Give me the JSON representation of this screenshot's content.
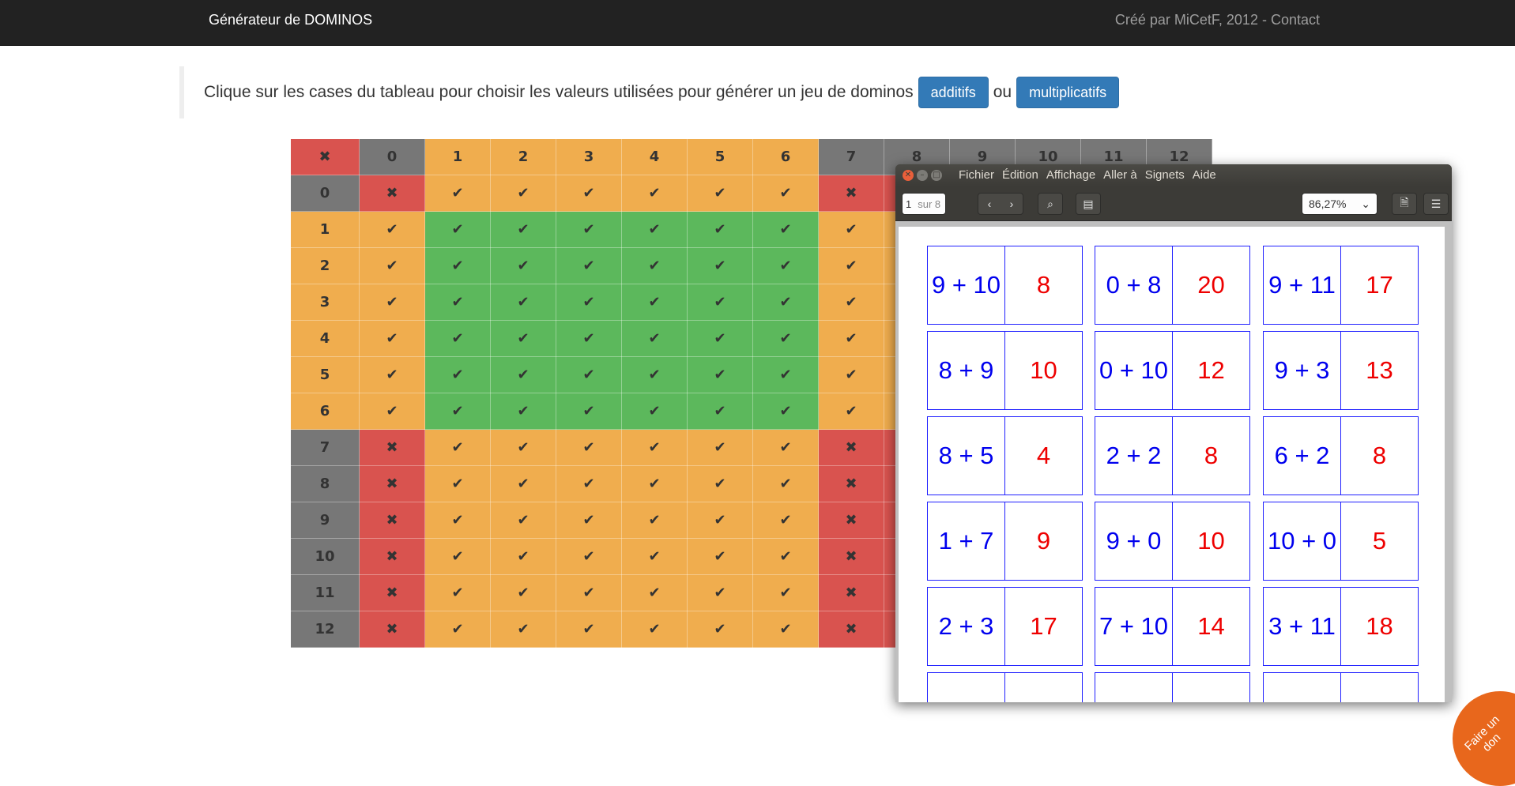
{
  "navbar": {
    "brand": "Générateur de DOMINOS",
    "credit": "Créé par MiCetF, 2012 - Contact"
  },
  "intro": {
    "text": "Clique sur les cases du tableau pour choisir les valeurs utilisées pour générer un jeu de dominos",
    "additifs_label": "additifs",
    "ou": "ou",
    "multiplicatifs_label": "multiplicatifs"
  },
  "table": {
    "corner": "✖",
    "check": "✔",
    "cross": "✖",
    "headers": [
      "0",
      "1",
      "2",
      "3",
      "4",
      "5",
      "6",
      "7",
      "8",
      "9",
      "10",
      "11",
      "12"
    ]
  },
  "viewer": {
    "menu": [
      "Fichier",
      "Édition",
      "Affichage",
      "Aller à",
      "Signets",
      "Aide"
    ],
    "page": "1",
    "page_of": "sur 8",
    "zoom": "86,27%",
    "dominoes": [
      {
        "left": "9 + 10",
        "right": "8"
      },
      {
        "left": "0 + 8",
        "right": "20"
      },
      {
        "left": "9 + 11",
        "right": "17"
      },
      {
        "left": "8 + 9",
        "right": "10"
      },
      {
        "left": "0 + 10",
        "right": "12"
      },
      {
        "left": "9 + 3",
        "right": "13"
      },
      {
        "left": "8 + 5",
        "right": "4"
      },
      {
        "left": "2 + 2",
        "right": "8"
      },
      {
        "left": "6 + 2",
        "right": "8"
      },
      {
        "left": "1 + 7",
        "right": "9"
      },
      {
        "left": "9 + 0",
        "right": "10"
      },
      {
        "left": "10 + 0",
        "right": "5"
      },
      {
        "left": "2 + 3",
        "right": "17"
      },
      {
        "left": "7 + 10",
        "right": "14"
      },
      {
        "left": "3 + 11",
        "right": "18"
      },
      {
        "left": "",
        "right": ""
      },
      {
        "left": "",
        "right": ""
      },
      {
        "left": "",
        "right": ""
      }
    ]
  },
  "donate": "Faire un\ndon"
}
